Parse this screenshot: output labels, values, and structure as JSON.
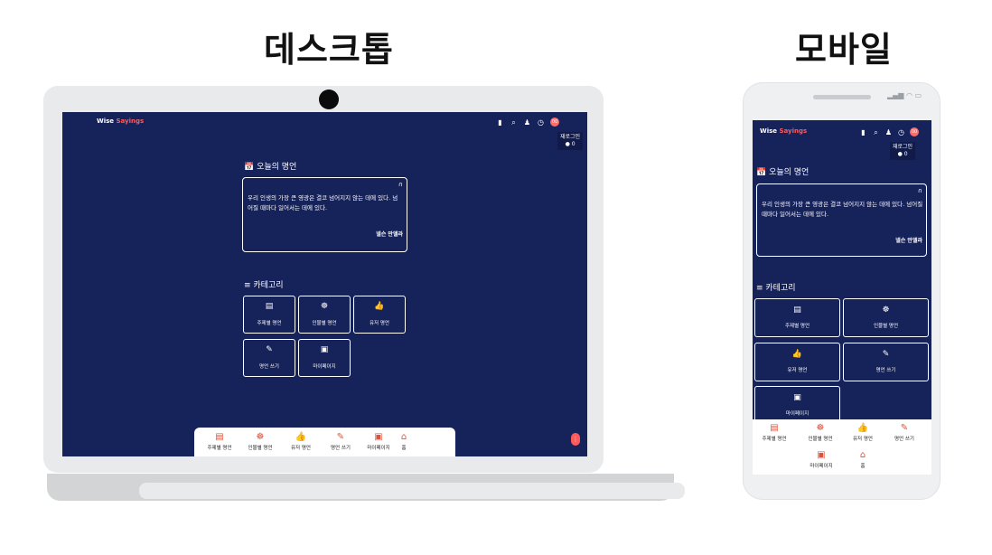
{
  "headings": {
    "desktop": "데스크톱",
    "mobile": "모바일"
  },
  "app": {
    "brand_main": "Wise ",
    "brand_accent": "Sayings",
    "login": {
      "label": "재로그인",
      "points": "● 0"
    },
    "badge_count": "00",
    "quote_section_title": "📅 오늘의 명언",
    "quote": {
      "text": "우리 인생의 가장 큰 영광은 결코 넘어지지 않는 데에 있다. 넘어질 때마다 일어서는 데에 있다.",
      "author": "넬슨 만델라"
    },
    "category_section_title": "≡ 카테고리",
    "categories": [
      {
        "icon": "▤",
        "label": "주제별 명언"
      },
      {
        "icon": "☸",
        "label": "인물별 명언"
      },
      {
        "icon": "👍",
        "label": "유저 명언"
      },
      {
        "icon": "✎",
        "label": "명언 쓰기"
      },
      {
        "icon": "▣",
        "label": "마이페이지"
      }
    ],
    "nav": [
      {
        "icon": "▤",
        "label": "주제별 명언"
      },
      {
        "icon": "☸",
        "label": "인물별 명언"
      },
      {
        "icon": "👍",
        "label": "유저 명언"
      },
      {
        "icon": "✎",
        "label": "명언 쓰기"
      },
      {
        "icon": "▣",
        "label": "마이페이지"
      },
      {
        "icon": "⌂",
        "label": "홈"
      }
    ]
  },
  "colors": {
    "app_bg": "#16225a",
    "accent": "#ff5a5a",
    "nav_icon": "#e0503a"
  }
}
